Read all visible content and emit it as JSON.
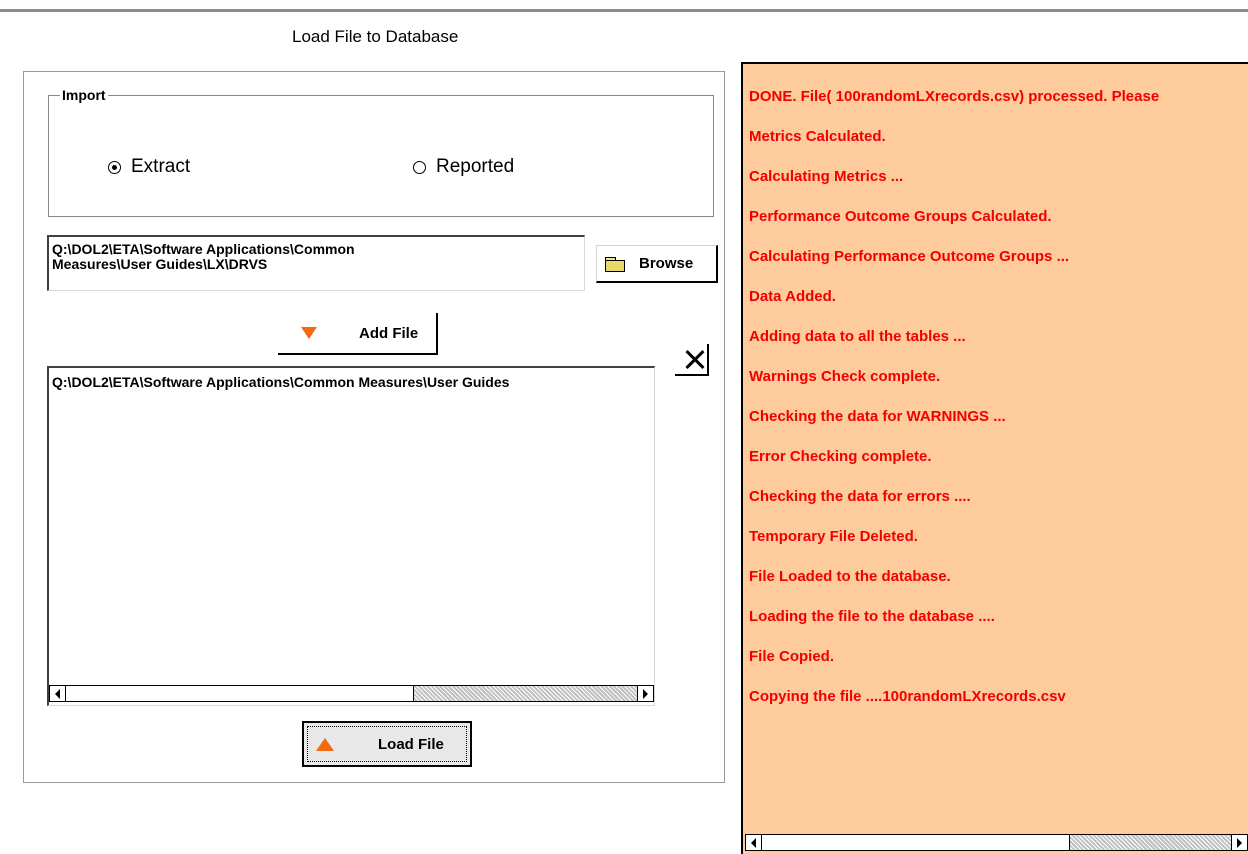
{
  "window_title": "Load File to Database",
  "import_group": {
    "legend": "Import",
    "options": [
      {
        "label": "Extract",
        "selected": true
      },
      {
        "label": "Reported",
        "selected": false
      }
    ]
  },
  "path_field": {
    "value": "Q:\\DOL2\\ETA\\Software Applications\\Common\nMeasures\\User Guides\\LX\\DRVS"
  },
  "buttons": {
    "browse": "Browse",
    "add_file": "Add File",
    "load_file": "Load File"
  },
  "file_list": {
    "items": [
      "Q:\\DOL2\\ETA\\Software Applications\\Common Measures\\User Guides"
    ]
  },
  "log": {
    "color": "#f20000",
    "background": "#fecb9c",
    "lines": [
      "DONE. File( 100randomLXrecords.csv) processed. Please",
      "Metrics Calculated.",
      "Calculating Metrics ...",
      "Performance Outcome Groups Calculated.",
      "Calculating Performance Outcome Groups ...",
      "Data Added.",
      "Adding data to all the tables ...",
      "Warnings Check complete.",
      "Checking the data for WARNINGS ...",
      "Error Checking complete.",
      "Checking the data for errors ....",
      "Temporary File Deleted.",
      "File Loaded to the database.",
      "Loading the file to the database ....",
      "File Copied.",
      "Copying the file ....100randomLXrecords.csv"
    ]
  },
  "icons": {
    "browse": "folder-icon",
    "add_file": "triangle-down-icon",
    "load_file": "triangle-up-icon",
    "remove": "close-icon"
  }
}
